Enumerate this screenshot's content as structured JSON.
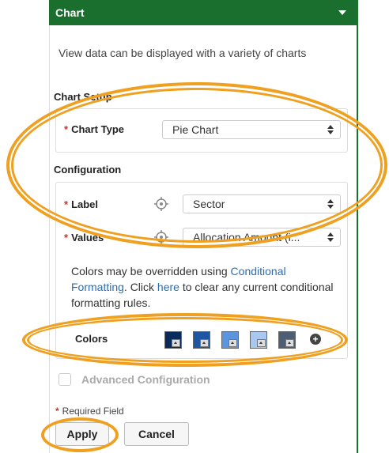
{
  "panel": {
    "title": "Chart",
    "description": "View data can be displayed with a variety of charts"
  },
  "chart_setup": {
    "title": "Chart Setup",
    "chart_type": {
      "label": "Chart Type",
      "value": "Pie Chart",
      "required_mark": "*"
    }
  },
  "configuration": {
    "title": "Configuration",
    "label_field": {
      "label": "Label",
      "value": "Sector",
      "required_mark": "*"
    },
    "values_field": {
      "label": "Values",
      "value": "Allocation Amount (i...",
      "required_mark": "*"
    },
    "note": {
      "text1": "Colors may be overridden using ",
      "link1": "Conditional Formatting",
      "text2": ". Click ",
      "link2": "here",
      "text3": " to clear any current conditional formatting rules."
    },
    "colors": {
      "label": "Colors",
      "swatches": [
        "#0b2a5c",
        "#1f56a3",
        "#5b95e0",
        "#a9c8f0",
        "#4f5d72"
      ],
      "add_icon": "plus-circle-icon"
    }
  },
  "advanced": {
    "label": "Advanced Configuration"
  },
  "footer": {
    "required_mark": "*",
    "required_text": "Required Field",
    "apply_label": "Apply",
    "cancel_label": "Cancel"
  },
  "colors": {
    "header_bg": "#1a6e2e",
    "highlight": "#f0a020",
    "required": "#c0392b",
    "link": "#2a6db0"
  }
}
